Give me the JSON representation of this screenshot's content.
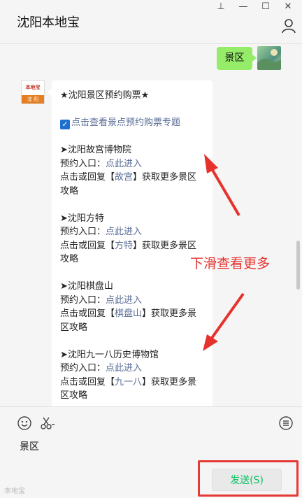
{
  "window": {
    "title": "沈阳本地宝",
    "controls": {
      "pin": "⊥",
      "minimize": "—",
      "maximize": "☐",
      "close": "✕"
    }
  },
  "chat": {
    "outgoing_message": "景区",
    "incoming_avatar": {
      "top_text": "本地宝",
      "bottom_text": "沈 阳"
    },
    "incoming": {
      "heading": "★沈阳景区预约购票★",
      "topic_link": "点击查看景点预约购票专题",
      "sections": [
        {
          "title": "➤沈阳故宫博物院",
          "entry_label": "预约入口：",
          "entry_link": "点此进入",
          "reply_prefix": "点击或回复【",
          "reply_keyword": "故宫",
          "reply_suffix": "】获取更多景区攻略"
        },
        {
          "title": "➤沈阳方特",
          "entry_label": "预约入口：",
          "entry_link": "点此进入",
          "reply_prefix": "点击或回复【",
          "reply_keyword": "方特",
          "reply_suffix": "】获取更多景区攻略"
        },
        {
          "title": "➤沈阳棋盘山",
          "entry_label": "预约入口：",
          "entry_link": "点此进入",
          "reply_prefix": "点击或回复【",
          "reply_keyword": "棋盘山",
          "reply_suffix": "】获取更多景区攻略"
        },
        {
          "title": "➤沈阳九一八历史博物馆",
          "entry_label": "预约入口：",
          "entry_link": "点此进入",
          "reply_prefix": "点击或回复【",
          "reply_keyword": "九一八",
          "reply_suffix": "】获取更多景区攻略"
        }
      ]
    },
    "annotation": "下滑查看更多"
  },
  "input": {
    "value": "景区",
    "send_label": "发送(S)",
    "watermark": "本地宝"
  },
  "colors": {
    "annotation": "#e5322d",
    "link": "#576b95",
    "bubble_out": "#95ec69",
    "send_text": "#07c160"
  },
  "icons": [
    "pin-icon",
    "minimize-icon",
    "maximize-icon",
    "close-icon",
    "user-icon",
    "emoji-icon",
    "scissors-icon",
    "history-icon"
  ]
}
